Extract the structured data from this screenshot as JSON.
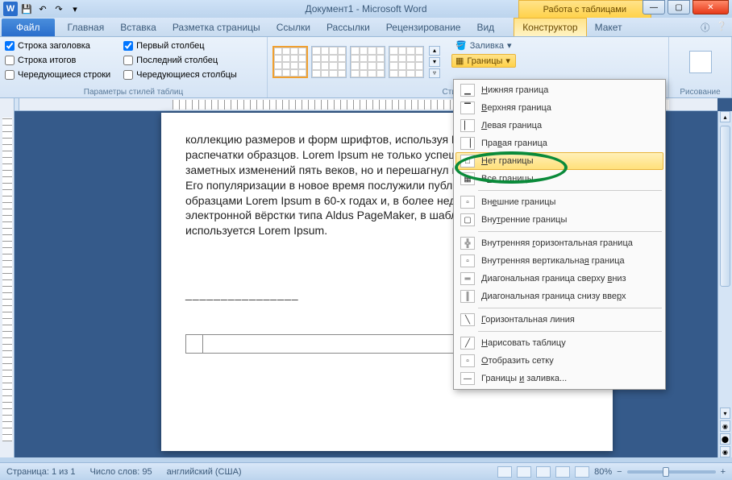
{
  "title_bar": {
    "doc_title": "Документ1 - Microsoft Word",
    "table_tools": "Работа с таблицами"
  },
  "qat": {
    "save": "💾",
    "undo": "↶",
    "redo": "↷"
  },
  "win": {
    "min": "—",
    "max": "▢",
    "close": "✕"
  },
  "tabs": {
    "file": "Файл",
    "items": [
      "Главная",
      "Вставка",
      "Разметка страницы",
      "Ссылки",
      "Рассылки",
      "Рецензирование",
      "Вид"
    ],
    "contextual": [
      "Конструктор",
      "Макет"
    ]
  },
  "ribbon": {
    "style_options": {
      "left": [
        {
          "label": "Строка заголовка",
          "checked": true
        },
        {
          "label": "Строка итогов",
          "checked": false
        },
        {
          "label": "Чередующиеся строки",
          "checked": false
        }
      ],
      "right": [
        {
          "label": "Первый столбец",
          "checked": true
        },
        {
          "label": "Последний столбец",
          "checked": false
        },
        {
          "label": "Чередующиеся столбцы",
          "checked": false
        }
      ],
      "group_label": "Параметры стилей таблиц"
    },
    "styles_label": "Стили таблиц",
    "fill_btn": "Заливка",
    "borders_btn": "Границы",
    "draw_label": "Рисование"
  },
  "dropdown": {
    "items": [
      {
        "label": "Нижняя граница",
        "u": 0
      },
      {
        "label": "Верхняя граница",
        "u": 0
      },
      {
        "label": "Левая граница",
        "u": 0
      },
      {
        "label": "Правая граница",
        "u": 3
      },
      {
        "label": "Нет границы",
        "u": 0,
        "hl": true
      },
      {
        "label": "Все границы",
        "u": 1
      },
      {
        "sep": true
      },
      {
        "label": "Внешние границы",
        "u": 2
      },
      {
        "label": "Внутренние границы",
        "u": 3
      },
      {
        "sep": true
      },
      {
        "label": "Внутренняя горизонтальная граница",
        "u": 11
      },
      {
        "label": "Внутренняя вертикальная граница",
        "u": 22
      },
      {
        "label": "Диагональная граница сверху вниз",
        "u": 28
      },
      {
        "label": "Диагональная граница снизу вверх",
        "u": 30
      },
      {
        "sep": true
      },
      {
        "label": "Горизонтальная линия",
        "u": 0
      },
      {
        "sep": true
      },
      {
        "label": "Нарисовать таблицу",
        "u": 0
      },
      {
        "label": "Отобразить сетку",
        "u": 0
      },
      {
        "label": "Границы и заливка...",
        "u": 8
      }
    ]
  },
  "document": {
    "body_text": "коллекцию размеров и форм шрифтов, используя Lorem Ipsum для распечатки образцов. Lorem Ipsum не только успешно пережил без заметных изменений пять веков, но и перешагнул в электронный дизайн. Его популяризации в новое время послужили публикация листов Letraset с образцами Lorem Ipsum в 60-х годах и, в более недавнее время, программы электронной вёрстки типа Aldus PageMaker, в шаблонах которых используется Lorem Ipsum.",
    "separator": "________________"
  },
  "ruler_corner": "L",
  "status": {
    "page": "Страница: 1 из 1",
    "words": "Число слов: 95",
    "lang": "английский (США)",
    "zoom": "80%"
  }
}
